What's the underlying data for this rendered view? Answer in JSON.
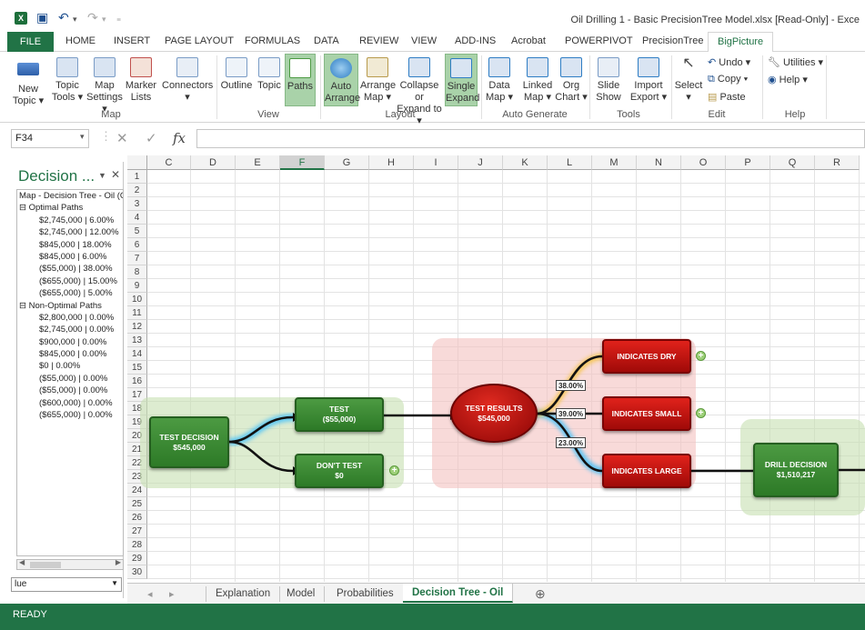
{
  "app": {
    "icon_label": "X",
    "title": "Oil Drilling 1 - Basic PrecisionTree Model.xlsx  [Read-Only] - Exce"
  },
  "ribbon_tabs": [
    "FILE",
    "HOME",
    "INSERT",
    "PAGE LAYOUT",
    "FORMULAS",
    "DATA",
    "REVIEW",
    "VIEW",
    "ADD-INS",
    "Acrobat",
    "POWERPIVOT",
    "PrecisionTree",
    "BigPicture"
  ],
  "ribbon": {
    "new_topic": [
      "New",
      "Topic ▾"
    ],
    "topic_tools": [
      "Topic",
      "Tools ▾"
    ],
    "map_settings": [
      "Map",
      "Settings ▾"
    ],
    "marker_lists": [
      "Marker",
      "Lists"
    ],
    "connectors": [
      "Connectors",
      "▾"
    ],
    "outline": "Outline",
    "topic": "Topic",
    "paths": "Paths",
    "auto_arrange": [
      "Auto",
      "Arrange"
    ],
    "arrange_map": [
      "Arrange",
      "Map ▾"
    ],
    "collapse_expand": [
      "Collapse or",
      "Expand to ▾"
    ],
    "single_expand": [
      "Single",
      "Expand"
    ],
    "data_map": [
      "Data",
      "Map ▾"
    ],
    "linked_map": [
      "Linked",
      "Map ▾"
    ],
    "org_chart": [
      "Org",
      "Chart ▾"
    ],
    "slide_show": [
      "Slide",
      "Show"
    ],
    "import_export": [
      "Import",
      "Export ▾"
    ],
    "select": [
      "Select",
      "▾"
    ],
    "undo": "Undo ▾",
    "copy": "Copy ▾",
    "paste": "Paste",
    "utilities": "Utilities ▾",
    "help": "Help ▾",
    "groups": [
      "Map",
      "View",
      "Layout",
      "Auto Generate",
      "Tools",
      "Edit",
      "Help"
    ]
  },
  "formula_bar": {
    "name_box": "F34",
    "fx": "fx",
    "value": ""
  },
  "task_pane": {
    "title": "Decision ...",
    "tree": [
      {
        "level": 0,
        "label": "Map - Decision Tree - Oil (Oil"
      },
      {
        "level": 1,
        "label": "⊟ Optimal Paths"
      },
      {
        "level": 2,
        "label": "$2,745,000  | 6.00%"
      },
      {
        "level": 2,
        "label": "$2,745,000  | 12.00%"
      },
      {
        "level": 2,
        "label": "$845,000  | 18.00%"
      },
      {
        "level": 2,
        "label": "$845,000  | 6.00%"
      },
      {
        "level": 2,
        "label": "($55,000)  | 38.00%"
      },
      {
        "level": 2,
        "label": "($655,000)  | 15.00%"
      },
      {
        "level": 2,
        "label": "($655,000)  | 5.00%"
      },
      {
        "level": 1,
        "label": "⊟ Non-Optimal Paths"
      },
      {
        "level": 2,
        "label": "$2,800,000  | 0.00%"
      },
      {
        "level": 2,
        "label": "$2,745,000  | 0.00%"
      },
      {
        "level": 2,
        "label": "$900,000  | 0.00%"
      },
      {
        "level": 2,
        "label": "$845,000  | 0.00%"
      },
      {
        "level": 2,
        "label": "$0  | 0.00%"
      },
      {
        "level": 2,
        "label": "($55,000)  | 0.00%"
      },
      {
        "level": 2,
        "label": "($55,000)  | 0.00%"
      },
      {
        "level": 2,
        "label": "($600,000)  | 0.00%"
      },
      {
        "level": 2,
        "label": "($655,000)  | 0.00%"
      }
    ],
    "select_value": "lue"
  },
  "grid": {
    "columns": [
      "C",
      "D",
      "E",
      "F",
      "G",
      "H",
      "I",
      "J",
      "K",
      "L",
      "M",
      "N",
      "O",
      "P",
      "Q",
      "R"
    ],
    "selected_column": "F",
    "rows": [
      "1",
      "2",
      "3",
      "4",
      "5",
      "6",
      "7",
      "8",
      "9",
      "10",
      "11",
      "12",
      "13",
      "14",
      "15",
      "16",
      "17",
      "18",
      "19",
      "20",
      "21",
      "22",
      "23",
      "24",
      "25",
      "26",
      "27",
      "28",
      "29",
      "30"
    ]
  },
  "diagram": {
    "test_decision": {
      "title": "TEST DECISION",
      "value": "$545,000"
    },
    "test": {
      "title": "TEST",
      "value": "($55,000)"
    },
    "dont_test": {
      "title": "DON'T TEST",
      "value": "$0"
    },
    "test_results": {
      "title": "TEST RESULTS",
      "value": "$545,000"
    },
    "indicates_dry": {
      "title": "INDICATES DRY"
    },
    "indicates_small": {
      "title": "INDICATES SMALL"
    },
    "indicates_large": {
      "title": "INDICATES LARGE"
    },
    "drill_decision": {
      "title": "DRILL DECISION",
      "value": "$1,510,217"
    },
    "prob_dry": "38.00%",
    "prob_small": "39.00%",
    "prob_large": "23.00%",
    "colors": {
      "green": "#2d7a27",
      "red": "#c00f0b",
      "highlight": "#4fc3f7"
    }
  },
  "sheet_tabs": {
    "tabs": [
      "Explanation",
      "Model",
      "Probabilities",
      "Decision Tree - Oil"
    ],
    "active": "Decision Tree - Oil",
    "add_label": "⊕"
  },
  "status": "READY"
}
